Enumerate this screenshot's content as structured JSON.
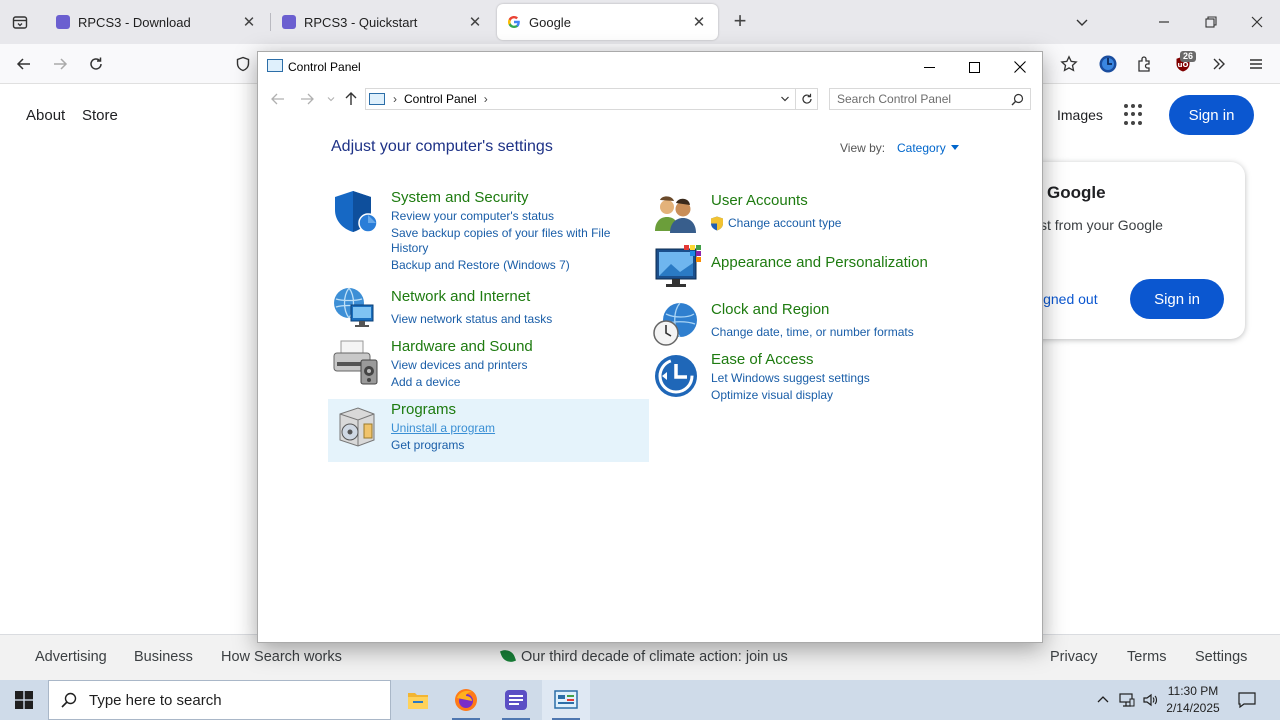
{
  "browser": {
    "tabs": [
      {
        "title": "RPCS3 - Download",
        "favicon": "rpcs3-icon",
        "active": false
      },
      {
        "title": "RPCS3 - Quickstart",
        "favicon": "rpcs3-icon",
        "active": false
      },
      {
        "title": "Google",
        "favicon": "google-icon",
        "active": true
      }
    ],
    "extension_badge": "26"
  },
  "google": {
    "top_links": [
      "About",
      "Store"
    ],
    "images_label": "Images",
    "signin_label": "Sign in",
    "card": {
      "title": "Google",
      "text": "st from your Google",
      "link": "igned out",
      "button": "Sign in"
    },
    "footer": {
      "left": [
        "Advertising",
        "Business",
        "How Search works"
      ],
      "center": "Our third decade of climate action: join us",
      "right": [
        "Privacy",
        "Terms",
        "Settings"
      ]
    }
  },
  "control_panel": {
    "window_title": "Control Panel",
    "breadcrumb": "Control Panel",
    "search_placeholder": "Search Control Panel",
    "heading": "Adjust your computer's settings",
    "view_by_label": "View by:",
    "view_by_value": "Category",
    "categories_left": [
      {
        "title": "System and Security",
        "icon": "shield-icon",
        "links": [
          "Review your computer's status",
          "Save backup copies of your files with File",
          "History",
          "Backup and Restore (Windows 7)"
        ]
      },
      {
        "title": "Network and Internet",
        "icon": "network-globe-icon",
        "links": [
          "View network status and tasks"
        ]
      },
      {
        "title": "Hardware and Sound",
        "icon": "printer-icon",
        "links": [
          "View devices and printers",
          "Add a device"
        ]
      },
      {
        "title": "Programs",
        "icon": "programs-box-icon",
        "links": [
          "Uninstall a program",
          "Get programs"
        ]
      }
    ],
    "categories_right": [
      {
        "title": "User Accounts",
        "icon": "users-icon",
        "links": [
          "Change account type"
        ]
      },
      {
        "title": "Appearance and Personalization",
        "icon": "monitor-palette-icon",
        "links": []
      },
      {
        "title": "Clock and Region",
        "icon": "clock-globe-icon",
        "links": [
          "Change date, time, or number formats"
        ]
      },
      {
        "title": "Ease of Access",
        "icon": "ease-of-access-icon",
        "links": [
          "Let Windows suggest settings",
          "Optimize visual display"
        ]
      }
    ]
  },
  "taskbar": {
    "search_placeholder": "Type here to search",
    "time": "11:30 PM",
    "date": "2/14/2025"
  },
  "colors": {
    "accent_blue": "#0b57d0",
    "cp_title_green": "#1e7b10",
    "cp_link_blue": "#1a5ea8",
    "cp_heading_blue": "#1e3287",
    "taskbar_bg": "#cfdbe9"
  }
}
